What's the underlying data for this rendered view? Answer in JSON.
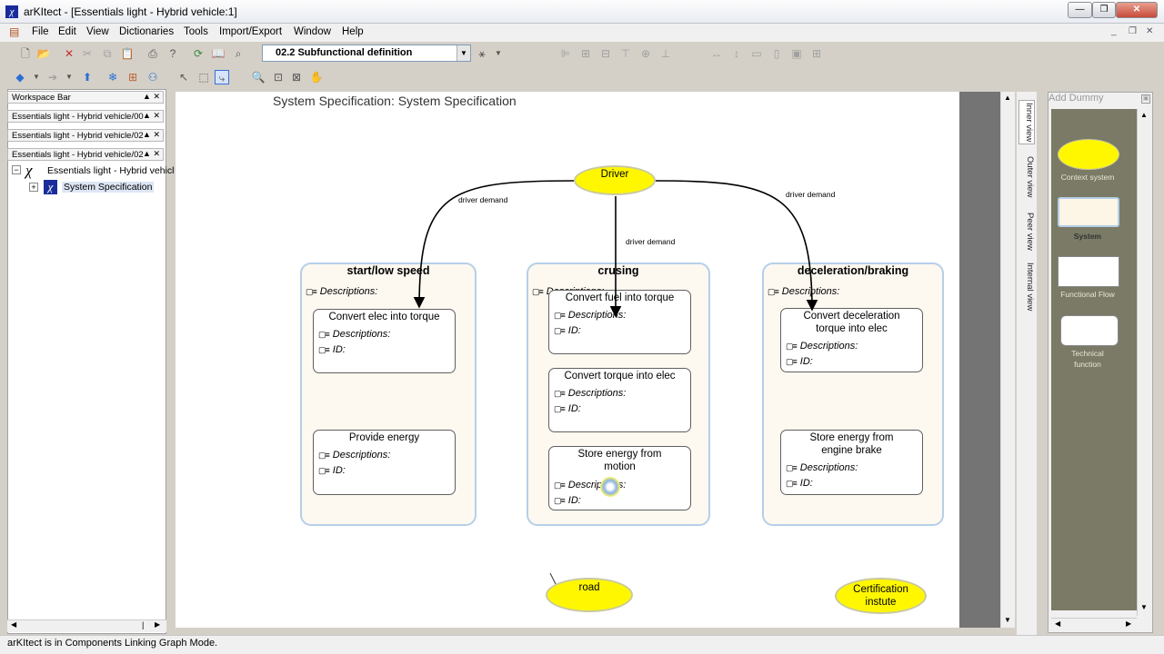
{
  "window": {
    "title": "arKItect - [Essentials light - Hybrid vehicle:1]"
  },
  "menu": {
    "items": [
      "File",
      "Edit",
      "View",
      "Dictionaries",
      "Tools",
      "Import/Export",
      "Window",
      "Help"
    ]
  },
  "toolbar": {
    "view_select": "02.2 Subfunctional definition"
  },
  "left": {
    "workspace_bar": "Workspace Bar",
    "bars": [
      "Essentials light - Hybrid vehicle/00",
      "Essentials light - Hybrid vehicle/02",
      "Essentials light - Hybrid vehicle/02"
    ],
    "tree_root": "Essentials light - Hybrid vehicl",
    "tree_child": "System Specification"
  },
  "diagram": {
    "title": "System Specification: System Specification",
    "containers": [
      {
        "title": "start/low speed",
        "attr": "Descriptions:"
      },
      {
        "title": "crusing",
        "attr": "Descriptions:"
      },
      {
        "title": "deceleration/braking",
        "attr": "Descriptions:"
      }
    ],
    "functions": [
      {
        "title": "Convert elec into torque",
        "attr1": "Descriptions:",
        "attr2": "ID:"
      },
      {
        "title": "Provide energy",
        "attr1": "Descriptions:",
        "attr2": "ID:"
      },
      {
        "title": "Convert fuel into torque",
        "attr1": "Descriptions:",
        "attr2": "ID:"
      },
      {
        "title": "Convert torque into elec",
        "attr1": "Descriptions:",
        "attr2": "ID:"
      },
      {
        "title": "Store energy from motion",
        "attr1": "Descriptions:",
        "attr2": "ID:"
      },
      {
        "title": "Convert deceleration torque into elec",
        "attr1": "Descriptions:",
        "attr2": "ID:"
      },
      {
        "title": "Store energy from engine brake",
        "attr1": "Descriptions:",
        "attr2": "ID:"
      }
    ],
    "externals": {
      "driver": "Driver",
      "road": "road",
      "cert": "Certification instute"
    },
    "edge_labels": [
      "driver demand",
      "driver demand",
      "driver demand"
    ]
  },
  "side_tabs": [
    "Inner view",
    "Outer view",
    "Peer view",
    "Internal view"
  ],
  "palette": {
    "header": "Add Dummy",
    "items": [
      "Context system",
      "System",
      "Functional Flow",
      "Technical function"
    ]
  },
  "status": {
    "text": "arKItect is in Components Linking Graph Mode."
  }
}
